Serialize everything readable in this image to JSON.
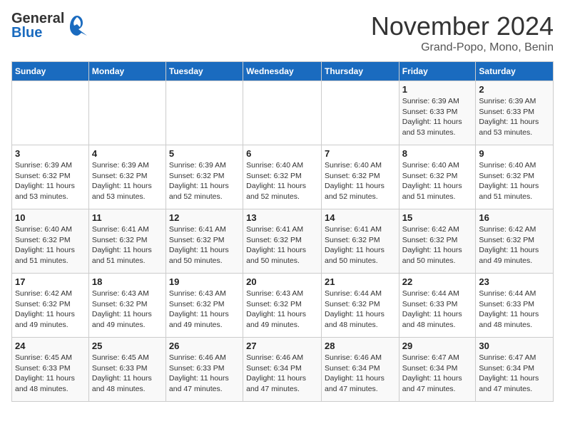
{
  "header": {
    "logo_general": "General",
    "logo_blue": "Blue",
    "month_title": "November 2024",
    "subtitle": "Grand-Popo, Mono, Benin"
  },
  "days_of_week": [
    "Sunday",
    "Monday",
    "Tuesday",
    "Wednesday",
    "Thursday",
    "Friday",
    "Saturday"
  ],
  "weeks": [
    [
      {
        "day": "",
        "info": ""
      },
      {
        "day": "",
        "info": ""
      },
      {
        "day": "",
        "info": ""
      },
      {
        "day": "",
        "info": ""
      },
      {
        "day": "",
        "info": ""
      },
      {
        "day": "1",
        "info": "Sunrise: 6:39 AM\nSunset: 6:33 PM\nDaylight: 11 hours and 53 minutes."
      },
      {
        "day": "2",
        "info": "Sunrise: 6:39 AM\nSunset: 6:33 PM\nDaylight: 11 hours and 53 minutes."
      }
    ],
    [
      {
        "day": "3",
        "info": "Sunrise: 6:39 AM\nSunset: 6:32 PM\nDaylight: 11 hours and 53 minutes."
      },
      {
        "day": "4",
        "info": "Sunrise: 6:39 AM\nSunset: 6:32 PM\nDaylight: 11 hours and 53 minutes."
      },
      {
        "day": "5",
        "info": "Sunrise: 6:39 AM\nSunset: 6:32 PM\nDaylight: 11 hours and 52 minutes."
      },
      {
        "day": "6",
        "info": "Sunrise: 6:40 AM\nSunset: 6:32 PM\nDaylight: 11 hours and 52 minutes."
      },
      {
        "day": "7",
        "info": "Sunrise: 6:40 AM\nSunset: 6:32 PM\nDaylight: 11 hours and 52 minutes."
      },
      {
        "day": "8",
        "info": "Sunrise: 6:40 AM\nSunset: 6:32 PM\nDaylight: 11 hours and 51 minutes."
      },
      {
        "day": "9",
        "info": "Sunrise: 6:40 AM\nSunset: 6:32 PM\nDaylight: 11 hours and 51 minutes."
      }
    ],
    [
      {
        "day": "10",
        "info": "Sunrise: 6:40 AM\nSunset: 6:32 PM\nDaylight: 11 hours and 51 minutes."
      },
      {
        "day": "11",
        "info": "Sunrise: 6:41 AM\nSunset: 6:32 PM\nDaylight: 11 hours and 51 minutes."
      },
      {
        "day": "12",
        "info": "Sunrise: 6:41 AM\nSunset: 6:32 PM\nDaylight: 11 hours and 50 minutes."
      },
      {
        "day": "13",
        "info": "Sunrise: 6:41 AM\nSunset: 6:32 PM\nDaylight: 11 hours and 50 minutes."
      },
      {
        "day": "14",
        "info": "Sunrise: 6:41 AM\nSunset: 6:32 PM\nDaylight: 11 hours and 50 minutes."
      },
      {
        "day": "15",
        "info": "Sunrise: 6:42 AM\nSunset: 6:32 PM\nDaylight: 11 hours and 50 minutes."
      },
      {
        "day": "16",
        "info": "Sunrise: 6:42 AM\nSunset: 6:32 PM\nDaylight: 11 hours and 49 minutes."
      }
    ],
    [
      {
        "day": "17",
        "info": "Sunrise: 6:42 AM\nSunset: 6:32 PM\nDaylight: 11 hours and 49 minutes."
      },
      {
        "day": "18",
        "info": "Sunrise: 6:43 AM\nSunset: 6:32 PM\nDaylight: 11 hours and 49 minutes."
      },
      {
        "day": "19",
        "info": "Sunrise: 6:43 AM\nSunset: 6:32 PM\nDaylight: 11 hours and 49 minutes."
      },
      {
        "day": "20",
        "info": "Sunrise: 6:43 AM\nSunset: 6:32 PM\nDaylight: 11 hours and 49 minutes."
      },
      {
        "day": "21",
        "info": "Sunrise: 6:44 AM\nSunset: 6:32 PM\nDaylight: 11 hours and 48 minutes."
      },
      {
        "day": "22",
        "info": "Sunrise: 6:44 AM\nSunset: 6:33 PM\nDaylight: 11 hours and 48 minutes."
      },
      {
        "day": "23",
        "info": "Sunrise: 6:44 AM\nSunset: 6:33 PM\nDaylight: 11 hours and 48 minutes."
      }
    ],
    [
      {
        "day": "24",
        "info": "Sunrise: 6:45 AM\nSunset: 6:33 PM\nDaylight: 11 hours and 48 minutes."
      },
      {
        "day": "25",
        "info": "Sunrise: 6:45 AM\nSunset: 6:33 PM\nDaylight: 11 hours and 48 minutes."
      },
      {
        "day": "26",
        "info": "Sunrise: 6:46 AM\nSunset: 6:33 PM\nDaylight: 11 hours and 47 minutes."
      },
      {
        "day": "27",
        "info": "Sunrise: 6:46 AM\nSunset: 6:34 PM\nDaylight: 11 hours and 47 minutes."
      },
      {
        "day": "28",
        "info": "Sunrise: 6:46 AM\nSunset: 6:34 PM\nDaylight: 11 hours and 47 minutes."
      },
      {
        "day": "29",
        "info": "Sunrise: 6:47 AM\nSunset: 6:34 PM\nDaylight: 11 hours and 47 minutes."
      },
      {
        "day": "30",
        "info": "Sunrise: 6:47 AM\nSunset: 6:34 PM\nDaylight: 11 hours and 47 minutes."
      }
    ]
  ]
}
